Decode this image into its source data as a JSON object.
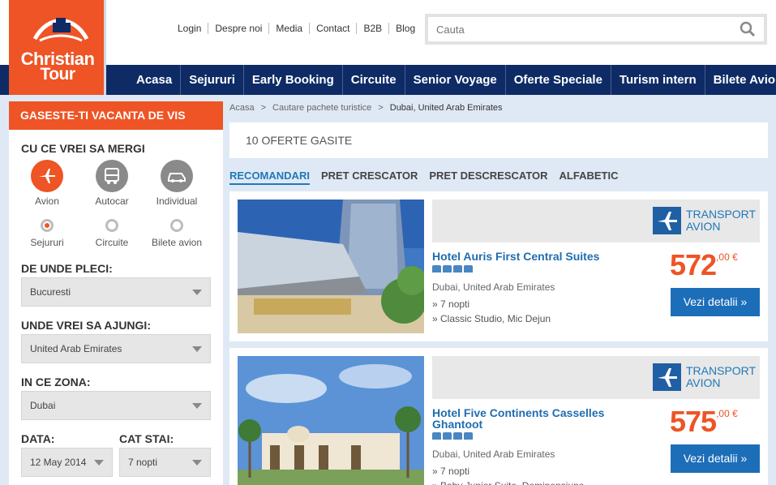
{
  "brand": {
    "line1": "Christian",
    "line2": "Tour",
    "color": "#ee5425"
  },
  "top_links": [
    "Login",
    "Despre noi",
    "Media",
    "Contact",
    "B2B",
    "Blog"
  ],
  "search": {
    "placeholder": "Cauta",
    "icon": "search-icon"
  },
  "nav": [
    "Acasa",
    "Sejururi",
    "Early Booking",
    "Circuite",
    "Senior Voyage",
    "Oferte Speciale",
    "Turism intern",
    "Bilete Avion"
  ],
  "sidebar": {
    "title": "GASESTE-TI VACANTA DE VIS",
    "where_label": "CU CE VREI SA MERGI",
    "transport_modes": [
      {
        "label": "Avion",
        "icon": "plane-icon",
        "active": true
      },
      {
        "label": "Autocar",
        "icon": "bus-icon",
        "active": false
      },
      {
        "label": "Individual",
        "icon": "car-icon",
        "active": false
      }
    ],
    "trip_types": [
      {
        "label": "Sejururi",
        "selected": true
      },
      {
        "label": "Circuite",
        "selected": false
      },
      {
        "label": "Bilete avion",
        "selected": false
      }
    ],
    "from_label": "DE UNDE PLECI:",
    "from_value": "Bucuresti",
    "to_label": "UNDE VREI SA AJUNGI:",
    "to_value": "United Arab Emirates",
    "zone_label": "IN CE ZONA:",
    "zone_value": "Dubai",
    "date_label": "DATA:",
    "date_value": "12 May 2014",
    "stay_label": "CAT STAI:",
    "stay_value": "7 nopti"
  },
  "breadcrumb": {
    "items": [
      "Acasa",
      "Cautare pachete turistice"
    ],
    "current": "Dubai, United Arab Emirates",
    "sep": ">"
  },
  "results": {
    "count_text": "10 OFERTE GASITE"
  },
  "sort_tabs": [
    {
      "label": "RECOMANDARI",
      "active": true
    },
    {
      "label": "PRET CRESCATOR",
      "active": false
    },
    {
      "label": "PRET DESCRESCATOR",
      "active": false
    },
    {
      "label": "ALFABETIC",
      "active": false
    }
  ],
  "offers": [
    {
      "transport_line1": "TRANSPORT",
      "transport_line2": "AVION",
      "name": "Hotel Auris First Central Suites",
      "stars": 4,
      "location": "Dubai, United Arab Emirates",
      "nights": "» 7 nopti",
      "room": "» Classic Studio, Mic Dejun",
      "price": "572",
      "price_cents": ",00 €",
      "cta": "Vezi detalii »"
    },
    {
      "transport_line1": "TRANSPORT",
      "transport_line2": "AVION",
      "name": "Hotel Five Continents Casselles Ghantoot",
      "stars": 4,
      "location": "Dubai, United Arab Emirates",
      "nights": "» 7 nopti",
      "room": "» Baby Junior Suite, Demipensiune",
      "price": "575",
      "price_cents": ",00 €",
      "cta": "Vezi detalii »"
    }
  ]
}
